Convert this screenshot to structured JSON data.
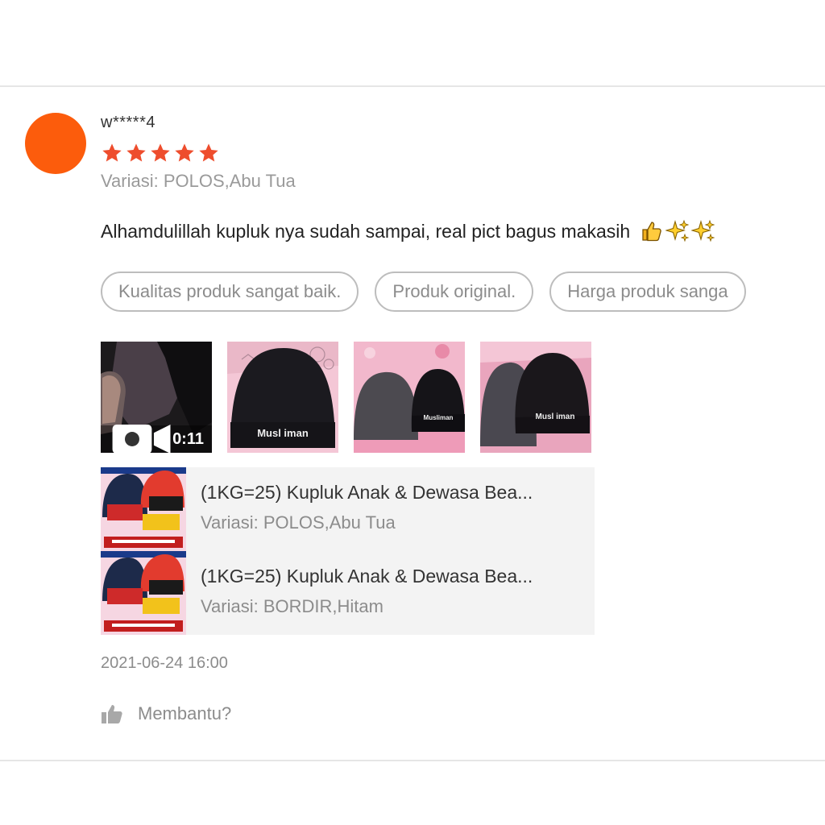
{
  "review": {
    "username": "w*****4",
    "rating": 5,
    "star_color": "#ee4d2d",
    "avatar_color": "#fc5c0c",
    "variation": "Variasi: POLOS,Abu Tua",
    "comment": "Alhamdulillah kupluk nya sudah sampai, real pict bagus makasih",
    "comment_emojis": [
      "thumbs-up-emoji",
      "sparkles-emoji",
      "sparkles-emoji"
    ],
    "tags": [
      "Kualitas produk sangat baik.",
      "Produk original.",
      "Harga produk sanga"
    ],
    "media": {
      "video_duration": "0:11",
      "photos": [
        {
          "caption": "Musl iman"
        },
        {
          "caption": "Musliman"
        },
        {
          "caption": "Musl iman"
        }
      ]
    },
    "products": [
      {
        "name": "(1KG=25) Kupluk Anak & Dewasa Bea...",
        "variation": "Variasi: POLOS,Abu Tua"
      },
      {
        "name": "(1KG=25) Kupluk Anak & Dewasa Bea...",
        "variation": "Variasi: BORDIR,Hitam"
      }
    ],
    "timestamp": "2021-06-24 16:00",
    "helpful_label": "Membantu?"
  }
}
